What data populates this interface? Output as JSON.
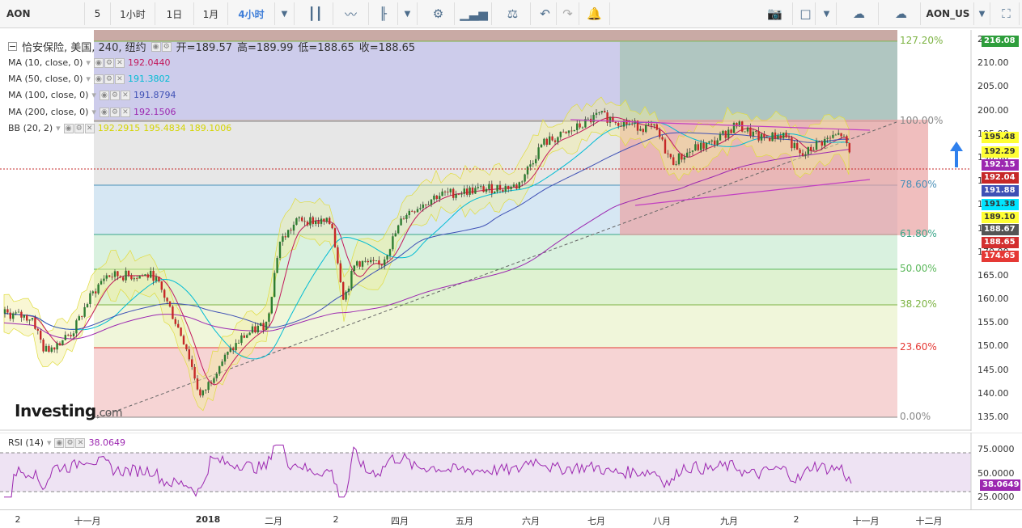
{
  "toolbar": {
    "symbol": "AON",
    "intervals": [
      "5",
      "1小时",
      "1日",
      "1月",
      "4小时"
    ],
    "active_interval": "4小时",
    "symbol_code": "AON_US"
  },
  "legend": {
    "title": "恰安保险, 美国, 240, 纽约",
    "ohlc": {
      "open": "开=189.57",
      "high": "高=189.99",
      "low": "低=188.65",
      "close": "收=188.65"
    },
    "ma10": {
      "label": "MA (10, close, 0)",
      "value": "192.0440",
      "color": "#c2185b"
    },
    "ma50": {
      "label": "MA (50, close, 0)",
      "value": "191.3802",
      "color": "#00bcd4"
    },
    "ma100": {
      "label": "MA (100, close, 0)",
      "value": "191.8794",
      "color": "#3f51b5"
    },
    "ma200": {
      "label": "MA (200, close, 0)",
      "value": "192.1506",
      "color": "#9c27b0"
    },
    "bb": {
      "label": "BB (20, 2)",
      "v1": "192.2915",
      "v2": "195.4834",
      "v3": "189.1006",
      "color": "#e6e600"
    }
  },
  "price_axis": [
    "215.00",
    "210.00",
    "205.00",
    "200.00",
    "195.00",
    "190.00",
    "185.00",
    "180.00",
    "175.00",
    "170.00",
    "165.00",
    "160.00",
    "155.00",
    "150.00",
    "145.00",
    "140.00",
    "135.00"
  ],
  "price_labels": [
    {
      "text": "216.08",
      "color": "#2e9e3c",
      "fg": "#fff"
    },
    {
      "text": "195.48",
      "color": "#ffff33",
      "fg": "#333"
    },
    {
      "text": "192.29",
      "color": "#ffff33",
      "fg": "#333"
    },
    {
      "text": "192.15",
      "color": "#9c27b0",
      "fg": "#fff"
    },
    {
      "text": "192.04",
      "color": "#c62828",
      "fg": "#fff"
    },
    {
      "text": "191.88",
      "color": "#3f51b5",
      "fg": "#fff"
    },
    {
      "text": "191.38",
      "color": "#00e5ff",
      "fg": "#333"
    },
    {
      "text": "189.10",
      "color": "#ffff33",
      "fg": "#333"
    },
    {
      "text": "188.67",
      "color": "#555555",
      "fg": "#fff"
    },
    {
      "text": "188.65",
      "color": "#d32f2f",
      "fg": "#fff"
    },
    {
      "text": "174.65",
      "color": "#e53935",
      "fg": "#fff"
    }
  ],
  "fib_levels": [
    {
      "label": "127.20%",
      "color": "#7cb342"
    },
    {
      "label": "100.00%",
      "color": "#888"
    },
    {
      "label": "78.60%",
      "color": "#4a90b8"
    },
    {
      "label": "61.80%",
      "color": "#3aa68a"
    },
    {
      "label": "50.00%",
      "color": "#5cb85c"
    },
    {
      "label": "38.20%",
      "color": "#7cb342"
    },
    {
      "label": "23.60%",
      "color": "#e53935"
    },
    {
      "label": "0.00%",
      "color": "#888"
    }
  ],
  "rsi": {
    "label": "RSI (14)",
    "value": "38.0649",
    "axis": [
      "75.0000",
      "50.0000",
      "25.0000"
    ],
    "color": "#9c27b0"
  },
  "time_axis": [
    "2",
    "十一月",
    "2018",
    "二月",
    "2",
    "四月",
    "五月",
    "六月",
    "七月",
    "八月",
    "九月",
    "2",
    "十一月",
    "十二月"
  ],
  "branding": {
    "logo": "Investing",
    "suffix": ".com"
  }
}
